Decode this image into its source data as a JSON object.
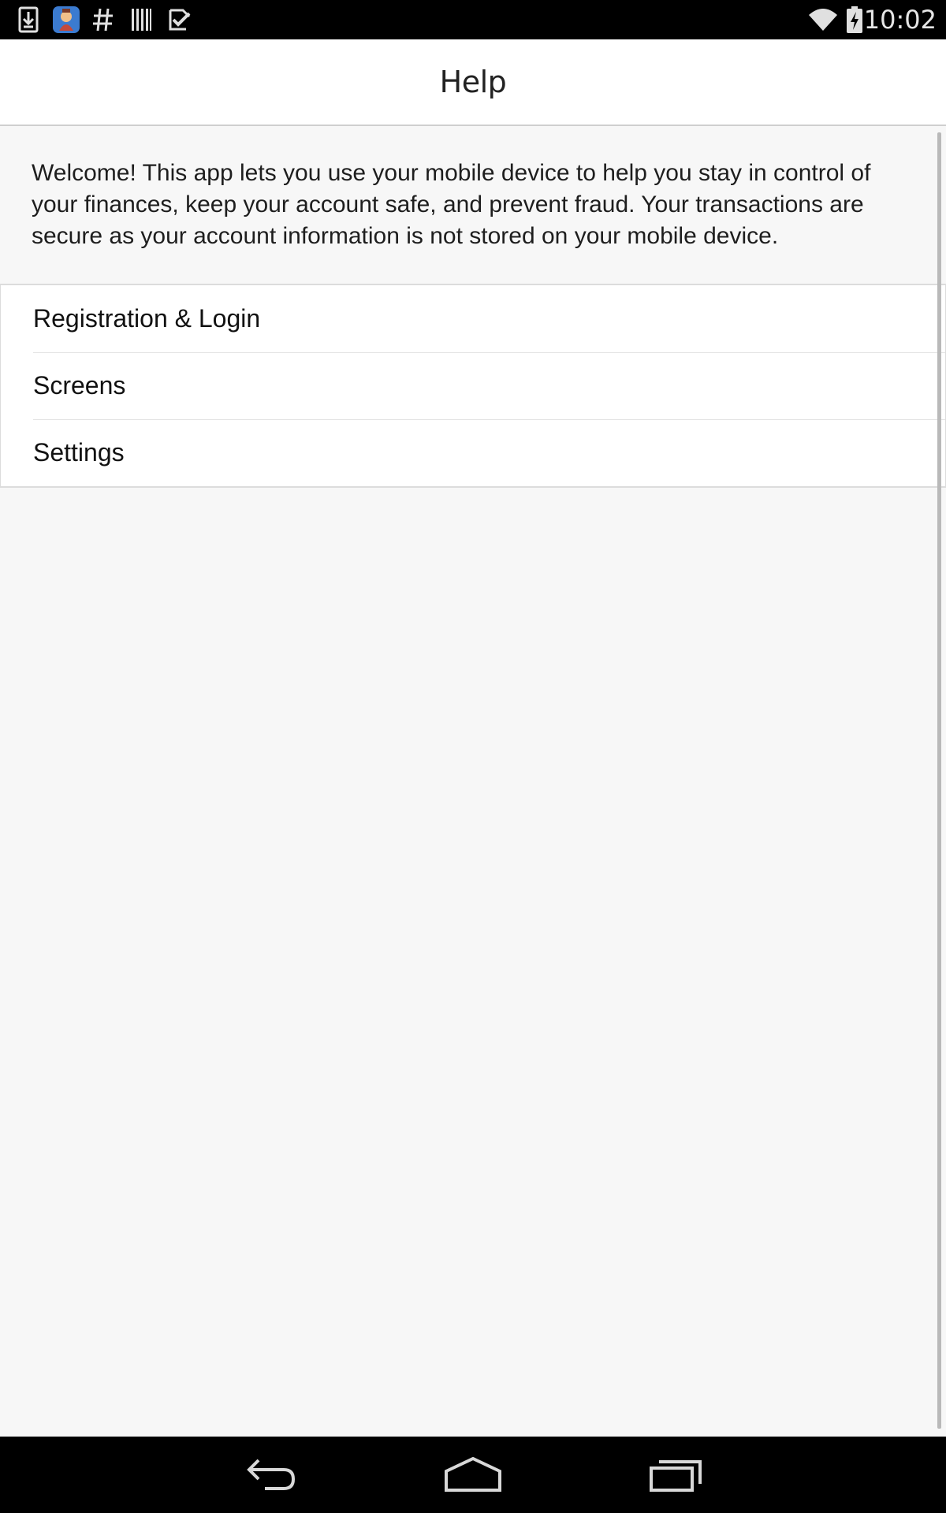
{
  "status_bar": {
    "time": "10:02",
    "left_icons": [
      "download-icon",
      "app-notification-icon",
      "hashtag-icon",
      "barcode-icon",
      "task-check-icon"
    ],
    "right_icons": [
      "wifi-icon",
      "battery-charging-icon"
    ]
  },
  "header": {
    "title": "Help"
  },
  "intro_text": "Welcome! This app lets you use your mobile device to help you stay in control of your finances, keep your account safe, and prevent fraud. Your transactions are secure as your account information is not stored on your mobile device.",
  "menu": {
    "items": [
      {
        "label": "Registration & Login"
      },
      {
        "label": "Screens"
      },
      {
        "label": "Settings"
      }
    ]
  },
  "nav_bar": {
    "icons": [
      "back-icon",
      "home-icon",
      "recent-apps-icon"
    ]
  }
}
